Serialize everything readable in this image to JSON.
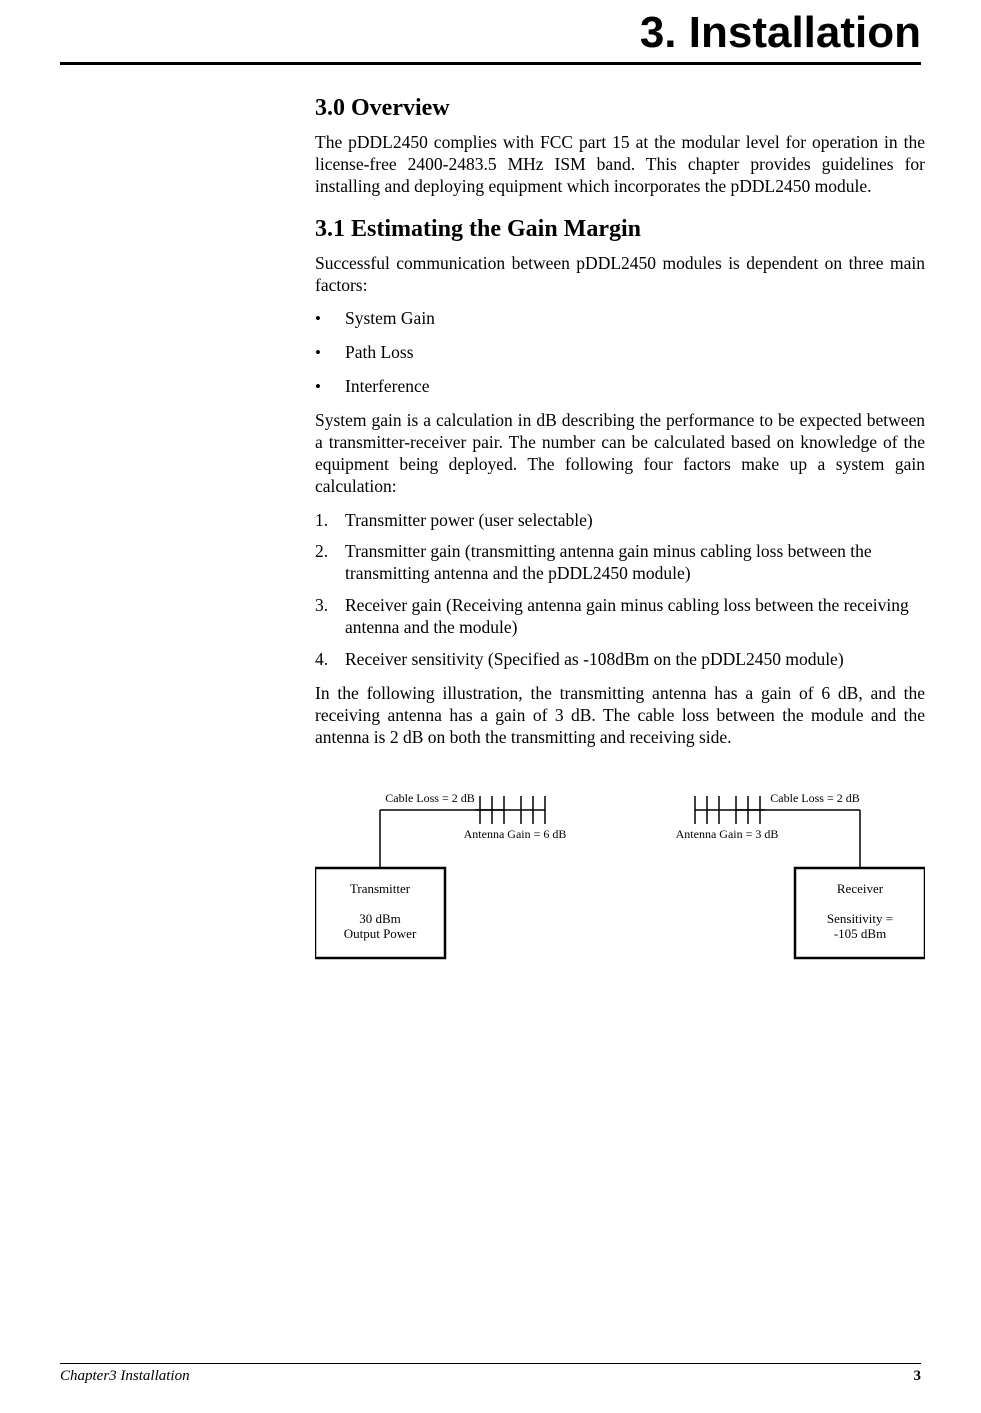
{
  "chapter": {
    "title": "3.  Installation"
  },
  "sections": {
    "s30": {
      "heading": "3.0   Overview",
      "p1": "The pDDL2450 complies with FCC part 15 at the modular level for operation in the license-free 2400-2483.5 MHz ISM band.  This chapter provides guidelines for installing and deploying equipment which incorporates the pDDL2450 module."
    },
    "s31": {
      "heading": "3.1   Estimating the Gain Margin",
      "p1": "Successful communication between pDDL2450 modules is dependent on three main factors:",
      "bullets": {
        "b1": "System Gain",
        "b2": "Path Loss",
        "b3": "Interference"
      },
      "p2": "System gain is a calculation in dB describing the performance to be expected between a transmitter-receiver pair.  The number can be calculated based on knowledge of the equipment being deployed.  The following four factors make up a system gain calculation:",
      "nums": {
        "n1": "Transmitter power (user selectable)",
        "n2": "Transmitter gain (transmitting antenna gain minus cabling loss between the transmitting antenna and the pDDL2450 module)",
        "n3": "Receiver gain (Receiving antenna gain minus cabling loss between the receiving antenna and the module)",
        "n4": "Receiver sensitivity (Specified as -108dBm on the pDDL2450 module)"
      },
      "p3": "In the following illustration, the transmitting antenna has a gain of 6 dB, and the receiving antenna has a gain of 3 dB.  The cable loss between the module and the antenna is 2 dB on both the transmitting and receiving side."
    }
  },
  "diagram": {
    "tx_cable_loss": "Cable Loss = 2 dB",
    "tx_gain": "Antenna Gain = 6 dB",
    "rx_cable_loss": "Cable Loss = 2 dB",
    "rx_gain": "Antenna Gain = 3 dB",
    "tx_title": "Transmitter",
    "tx_line1": "30 dBm",
    "tx_line2": "Output Power",
    "rx_title": "Receiver",
    "rx_line1": "Sensitivity =",
    "rx_line2": "-105 dBm"
  },
  "footer": {
    "left": "Chapter3 Installation",
    "page": "3"
  }
}
